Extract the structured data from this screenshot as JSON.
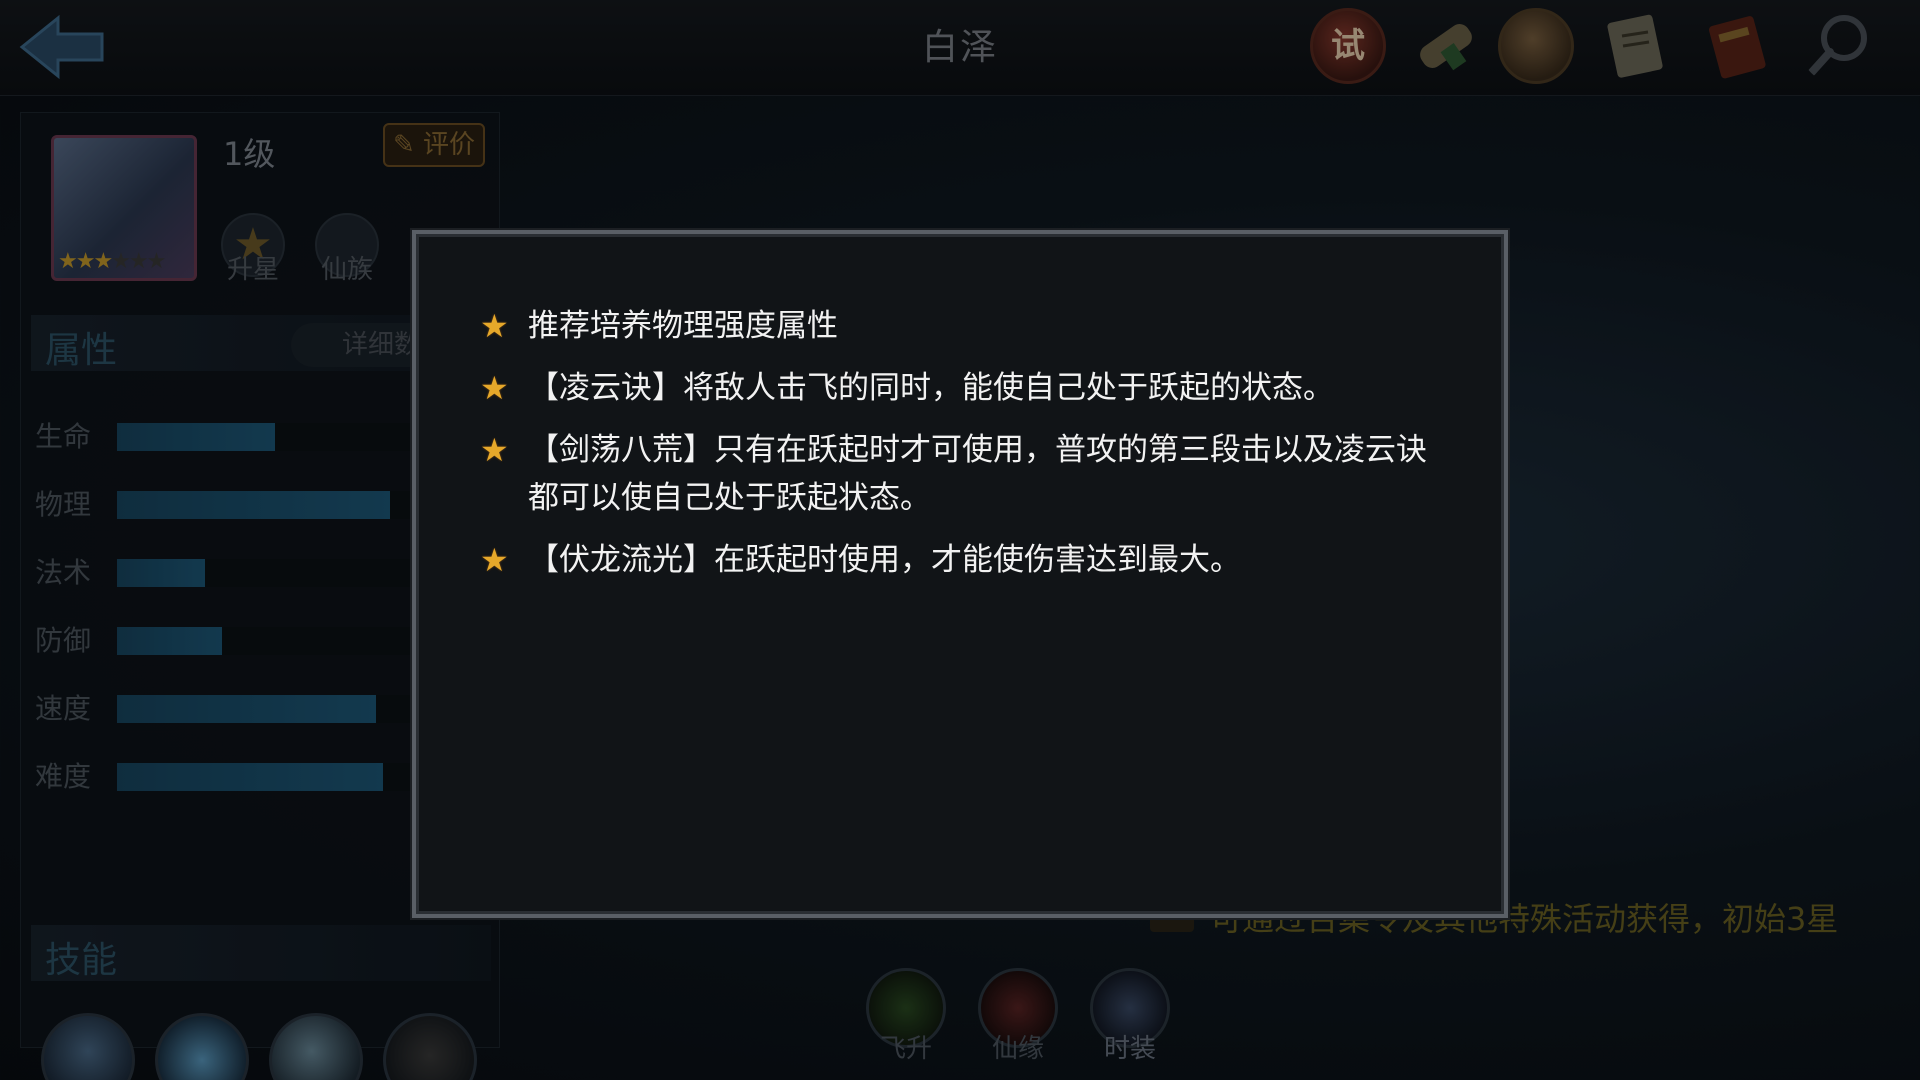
{
  "header": {
    "title": "白泽",
    "back_icon": "back-arrow-icon"
  },
  "top_icons": [
    {
      "name": "trial-icon",
      "glyph": "试"
    },
    {
      "name": "scroll-icon"
    },
    {
      "name": "coin-icon"
    },
    {
      "name": "document-icon"
    },
    {
      "name": "book-icon"
    },
    {
      "name": "magnifier-icon"
    }
  ],
  "hero": {
    "level": "1级",
    "rate_label": "评价",
    "stars_filled": 3,
    "stars_total": 6,
    "upgrade_star_label": "升星",
    "clan_label": "仙族"
  },
  "attributes": {
    "heading": "属性",
    "detail_label": "详细数",
    "stats": [
      {
        "label": "生命",
        "fill": 0.45
      },
      {
        "label": "物理",
        "fill": 0.78
      },
      {
        "label": "法术",
        "fill": 0.25
      },
      {
        "label": "防御",
        "fill": 0.3
      },
      {
        "label": "速度",
        "fill": 0.74
      },
      {
        "label": "难度",
        "fill": 0.76
      }
    ]
  },
  "skills": {
    "heading": "技能"
  },
  "bottom_tabs": [
    {
      "label": "飞升"
    },
    {
      "label": "仙缘"
    },
    {
      "label": "时装"
    }
  ],
  "obtain_text": "可通过召集令及其他特殊活动获得，初始3星",
  "tips": [
    {
      "text": "推荐培养物理强度属性"
    },
    {
      "text": "【凌云诀】将敌人击飞的同时，能使自己处于跃起的状态。"
    },
    {
      "text": "【剑荡八荒】只有在跃起时才可使用，普攻的第三段击以及凌云诀都可以使自己处于跃起状态。"
    },
    {
      "text": "【伏龙流光】在跃起时使用，才能使伤害达到最大。"
    }
  ],
  "colors": {
    "star": "#e6a82a",
    "stat_fill": "#1d5878",
    "gold_text": "#6b6122"
  }
}
